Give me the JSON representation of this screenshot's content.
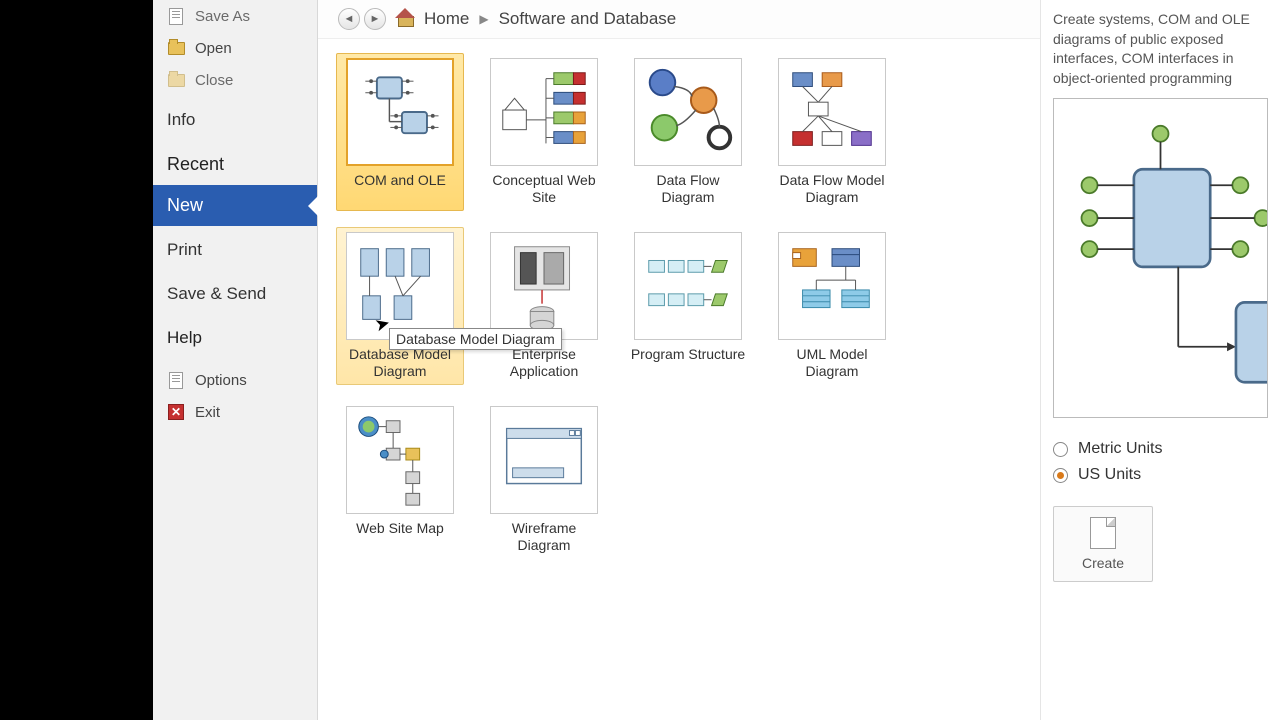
{
  "sidebar": {
    "save_as": "Save As",
    "open": "Open",
    "close": "Close",
    "info": "Info",
    "recent": "Recent",
    "new": "New",
    "print": "Print",
    "save_send": "Save & Send",
    "help": "Help",
    "options": "Options",
    "exit": "Exit"
  },
  "breadcrumb": {
    "home": "Home",
    "category": "Software and Database"
  },
  "templates": [
    {
      "id": "com-ole",
      "label": "COM and OLE"
    },
    {
      "id": "conceptual-web",
      "label": "Conceptual Web Site"
    },
    {
      "id": "data-flow",
      "label": "Data Flow Diagram"
    },
    {
      "id": "data-flow-model",
      "label": "Data Flow Model Diagram"
    },
    {
      "id": "db-model",
      "label": "Database Model Diagram"
    },
    {
      "id": "enterprise-app",
      "label": "Enterprise Application"
    },
    {
      "id": "program-struct",
      "label": "Program Structure"
    },
    {
      "id": "uml-model",
      "label": "UML Model Diagram"
    },
    {
      "id": "web-site-map",
      "label": "Web Site Map"
    },
    {
      "id": "wireframe",
      "label": "Wireframe Diagram"
    }
  ],
  "tooltip": "Database Model Diagram",
  "detail": {
    "desc": "Create systems, COM and OLE diagrams of public exposed interfaces, COM interfaces in object-oriented programming",
    "metric": "Metric Units",
    "us": "US Units",
    "create": "Create"
  }
}
